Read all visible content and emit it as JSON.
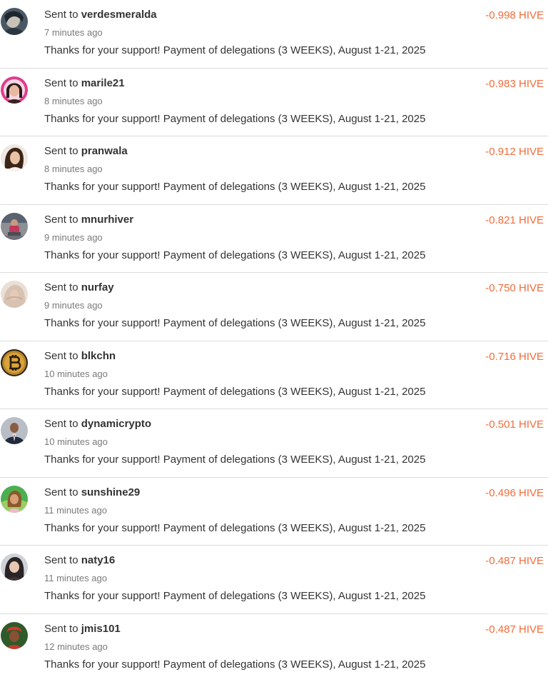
{
  "theme": {
    "amount_color": "#f26b3a",
    "divider_color": "#dcdcdc",
    "timestamp_color": "#7a7a7a"
  },
  "transfers": [
    {
      "prefix": "Sent to",
      "user": "verdesmeralda",
      "time": "7 minutes ago",
      "memo": "Thanks for your support! Payment of delegations (3 WEEKS), August 1-21, 2025",
      "amount": "-0.998 HIVE",
      "avatar_icon": "user-avatar-photo-icon"
    },
    {
      "prefix": "Sent to",
      "user": "marile21",
      "time": "8 minutes ago",
      "memo": "Thanks for your support! Payment of delegations (3 WEEKS), August 1-21, 2025",
      "amount": "-0.983 HIVE",
      "avatar_icon": "user-avatar-photo-icon"
    },
    {
      "prefix": "Sent to",
      "user": "pranwala",
      "time": "8 minutes ago",
      "memo": "Thanks for your support! Payment of delegations (3 WEEKS), August 1-21, 2025",
      "amount": "-0.912 HIVE",
      "avatar_icon": "user-avatar-photo-icon"
    },
    {
      "prefix": "Sent to",
      "user": "mnurhiver",
      "time": "9 minutes ago",
      "memo": "Thanks for your support! Payment of delegations (3 WEEKS), August 1-21, 2025",
      "amount": "-0.821 HIVE",
      "avatar_icon": "user-avatar-photo-icon"
    },
    {
      "prefix": "Sent to",
      "user": "nurfay",
      "time": "9 minutes ago",
      "memo": "Thanks for your support! Payment of delegations (3 WEEKS), August 1-21, 2025",
      "amount": "-0.750 HIVE",
      "avatar_icon": "user-avatar-photo-icon"
    },
    {
      "prefix": "Sent to",
      "user": "blkchn",
      "time": "10 minutes ago",
      "memo": "Thanks for your support! Payment of delegations (3 WEEKS), August 1-21, 2025",
      "amount": "-0.716 HIVE",
      "avatar_icon": "bitcoin-avatar-icon"
    },
    {
      "prefix": "Sent to",
      "user": "dynamicrypto",
      "time": "10 minutes ago",
      "memo": "Thanks for your support! Payment of delegations (3 WEEKS), August 1-21, 2025",
      "amount": "-0.501 HIVE",
      "avatar_icon": "user-avatar-photo-icon"
    },
    {
      "prefix": "Sent to",
      "user": "sunshine29",
      "time": "11 minutes ago",
      "memo": "Thanks for your support! Payment of delegations (3 WEEKS), August 1-21, 2025",
      "amount": "-0.496 HIVE",
      "avatar_icon": "user-avatar-photo-icon"
    },
    {
      "prefix": "Sent to",
      "user": "naty16",
      "time": "11 minutes ago",
      "memo": "Thanks for your support! Payment of delegations (3 WEEKS), August 1-21, 2025",
      "amount": "-0.487 HIVE",
      "avatar_icon": "user-avatar-photo-icon"
    },
    {
      "prefix": "Sent to",
      "user": "jmis101",
      "time": "12 minutes ago",
      "memo": "Thanks for your support! Payment of delegations (3 WEEKS), August 1-21, 2025",
      "amount": "-0.487 HIVE",
      "avatar_icon": "user-avatar-photo-icon"
    }
  ]
}
